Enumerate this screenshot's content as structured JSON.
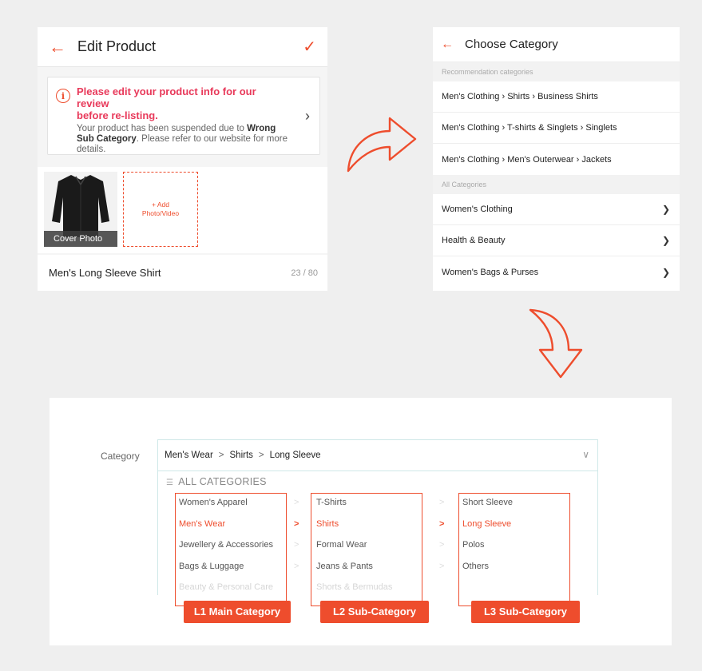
{
  "edit_product": {
    "back_icon": "arrow-left-icon",
    "title": "Edit Product",
    "confirm_icon": "check-icon",
    "warning": {
      "icon": "info-icon",
      "title_line1": "Please edit your product info for our review",
      "title_line2": "before re-listing.",
      "body_pre": "Your product has been suspended due to ",
      "body_bold": "Wrong Sub Category",
      "body_post": ". Please refer to our website for more details."
    },
    "cover_label": "Cover Photo",
    "add_label_1": "+ Add",
    "add_label_2": "Photo/Video",
    "product_name": "Men's Long Sleeve Shirt",
    "char_count": "23 / 80"
  },
  "choose_category": {
    "back_icon": "arrow-left-icon",
    "title": "Choose Category",
    "recommend_header": "Recommendation categories",
    "recommendations": [
      "Men's Clothing › Shirts ›  Business Shirts",
      "Men's Clothing › T-shirts & Singlets › Singlets",
      "Men's Clothing › Men's Outerwear › Jackets"
    ],
    "all_header": "All Categories",
    "all_items": [
      "Women's Clothing",
      "Health & Beauty",
      "Women's Bags & Purses"
    ]
  },
  "picker": {
    "category_label": "Category",
    "breadcrumb": [
      "Men's Wear",
      "Shirts",
      "Long Sleeve"
    ],
    "all_categories": "ALL CATEGORIES",
    "l1": [
      "Women's Apparel",
      "Men's Wear",
      "Jewellery & Accessories",
      "Bags & Luggage",
      "Beauty & Personal Care"
    ],
    "l2": [
      "T-Shirts",
      "Shirts",
      "Formal Wear",
      "Jeans & Pants",
      "Shorts & Bermudas"
    ],
    "l3": [
      "Short Sleeve",
      "Long Sleeve",
      "Polos",
      "Others"
    ],
    "tag_l1": "L1 Main Category",
    "tag_l2": "L2 Sub-Category",
    "tag_l3": "L3 Sub-Category"
  },
  "colors": {
    "accent": "#ee4d2d",
    "warning_text": "#e8395a"
  }
}
